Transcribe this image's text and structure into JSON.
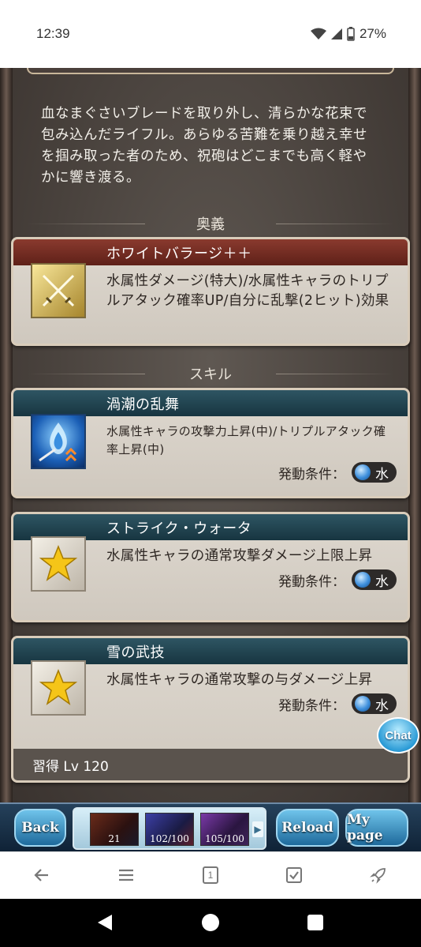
{
  "status_bar": {
    "time": "12:39",
    "battery": "27%"
  },
  "description": "血なまぐさいブレードを取り外し、清らかな花束で包み込んだライフル。あらゆる苦難を乗り越え幸せを掴み取った者のため、祝砲はどこまでも高く軽やかに響き渡る。",
  "sections": {
    "ougi": "奥義",
    "skill": "スキル"
  },
  "ougi": {
    "name": "ホワイトバラージ＋＋",
    "text": "水属性ダメージ(特大)/水属性キャラのトリプルアタック確率UP/自分に乱撃(2ヒット)効果",
    "icon": "crossed-swords-icon"
  },
  "skills": [
    {
      "name": "渦潮の乱舞",
      "text": "水属性キャラの攻撃力上昇(中)/トリプルアタック確率上昇(中)",
      "cond_label": "発動条件：",
      "cond_value": "水",
      "icon": "water-flame-icon"
    },
    {
      "name": "ストライク・ウォータ",
      "text": "水属性キャラの通常攻撃ダメージ上限上昇",
      "cond_label": "発動条件：",
      "cond_value": "水",
      "icon": "star-icon"
    },
    {
      "name": "雪の武技",
      "text": "水属性キャラの通常攻撃の与ダメージ上昇",
      "cond_label": "発動条件：",
      "cond_value": "水",
      "icon": "star-icon",
      "learn": "習得 Lv 120"
    }
  ],
  "chat": "Chat",
  "game_nav": {
    "back": "Back",
    "thumbs": [
      "21",
      "102/100",
      "105/100"
    ],
    "reload": "Reload",
    "mypage": "My page"
  },
  "browser_toolbar": {
    "tab_count": "1"
  }
}
